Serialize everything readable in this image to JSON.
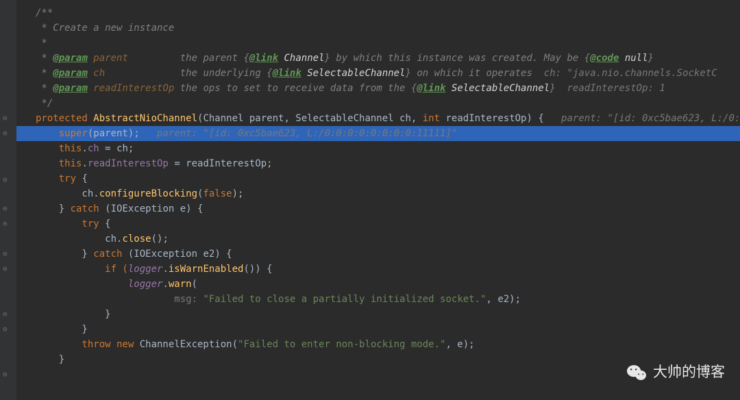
{
  "gutter_marks": [
    "⊖",
    "⊖",
    "⊖",
    "⊖",
    "⊖",
    "⊖",
    "⊖",
    "⊖",
    "⊖",
    "⊖",
    "⊖"
  ],
  "code": {
    "l1": "/**",
    "l2_pre": " * Create a new instance",
    "l3_pre": " *",
    "l4_pre": " * ",
    "l4_tag": "@param",
    "l4_name": " parent",
    "l4_pad": "         ",
    "l4_mid": "the parent {",
    "l4_link": "@link",
    "l4_link_txt": " Channel",
    "l4_rest": "} by which this instance was created. May be {",
    "l4_code": "@code",
    "l4_null": " null",
    "l4_close": "}",
    "l5_pre": " * ",
    "l5_tag": "@param",
    "l5_name": " ch",
    "l5_pad": "             ",
    "l5_mid": "the underlying {",
    "l5_link": "@link",
    "l5_link_txt": " SelectableChannel",
    "l5_rest": "} on which it operates",
    "l5_hint": "  ch: \"java.nio.channels.SocketC",
    "l6_pre": " * ",
    "l6_tag": "@param",
    "l6_name": " readInterestOp",
    "l6_pad": " ",
    "l6_mid": "the ops to set to receive data from the {",
    "l6_link": "@link",
    "l6_link_txt": " SelectableChannel",
    "l6_close": "}",
    "l6_hint": "  readInterestOp: 1",
    "l7": " */",
    "l8_kw": "protected",
    "l8_name": " AbstractNioChannel",
    "l8_sig1": "(Channel parent, SelectableChannel ch, ",
    "l8_int": "int",
    "l8_sig2": " readInterestOp) {",
    "l8_hint": "   parent: \"[id: 0xc5bae623, L:/0:",
    "l9_super": "    super",
    "l9_rest": "(parent);",
    "l9_hint": "   parent: \"[id: 0xc5bae623, L:/0:0:0:0:0:0:0:0:11111]\"",
    "l10_this": "    this",
    "l10_dot": ".",
    "l10_field": "ch",
    "l10_eq": " = ch;",
    "l11_this": "    this",
    "l11_dot": ".",
    "l11_field": "readInterestOp",
    "l11_eq": " = readInterestOp;",
    "l12_try": "    try ",
    "l12_brace": "{",
    "l13_pre": "        ch.",
    "l13_m": "configureBlocking",
    "l13_open": "(",
    "l13_false": "false",
    "l13_close": ");",
    "l14_pre": "    } ",
    "l14_catch": "catch",
    "l14_rest": " (IOException e) {",
    "l15_try": "        try ",
    "l15_brace": "{",
    "l16_pre": "            ch.",
    "l16_m": "close",
    "l16_close": "();",
    "l17_pre": "        } ",
    "l17_catch": "catch",
    "l17_rest": " (IOException e2) {",
    "l18_pre": "            if (",
    "l18_logger": "logger",
    "l18_dot": ".",
    "l18_m": "isWarnEnabled",
    "l18_close": "()) {",
    "l19_pre": "                ",
    "l19_logger": "logger",
    "l19_dot": ".",
    "l19_m": "warn",
    "l19_open": "(",
    "l20_pre": "                        ",
    "l20_hintlabel": "msg: ",
    "l20_str": "\"Failed to close a partially initialized socket.\"",
    "l20_rest": ", e2);",
    "l21": "            }",
    "l22": "        }",
    "l23": "",
    "l24_pre": "        throw new ",
    "l24_cls": "ChannelException(",
    "l24_str": "\"Failed to enter non-blocking mode.\"",
    "l24_rest": ", e);",
    "l25": "    }"
  },
  "watermark": {
    "text": "大帅的博客",
    "icon": "wechat"
  }
}
